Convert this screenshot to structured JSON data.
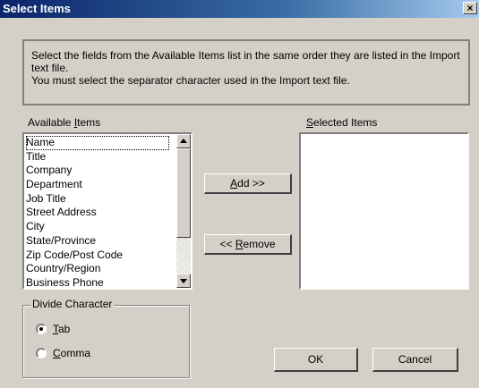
{
  "window": {
    "title": "Select Items",
    "close_glyph": "×"
  },
  "info": {
    "line1": "Select the fields from the Available Items list in the same order they are listed in the Import text file.",
    "line2": "You must select the separator character used in the Import text file."
  },
  "available": {
    "label_pre": "Available ",
    "label_mnemonic": "I",
    "label_post": "tems",
    "items": [
      "Name",
      "Title",
      "Company",
      "Department",
      "Job Title",
      "Street Address",
      "City",
      "State/Province",
      "Zip Code/Post Code",
      "Country/Region",
      "Business Phone"
    ]
  },
  "selected": {
    "label_mnemonic": "S",
    "label_post": "elected Items",
    "items": []
  },
  "buttons": {
    "add_mnemonic": "A",
    "add_post": "dd >>",
    "remove_pre": "<< ",
    "remove_mnemonic": "R",
    "remove_post": "emove",
    "ok": "OK",
    "cancel": "Cancel"
  },
  "divide": {
    "legend": "Divide Character",
    "tab_mnemonic": "T",
    "tab_post": "ab",
    "comma_mnemonic": "C",
    "comma_post": "omma",
    "selected": "tab"
  },
  "colors": {
    "face": "#d4d0c8",
    "title_start": "#0a246a",
    "title_end": "#a6caf0"
  }
}
